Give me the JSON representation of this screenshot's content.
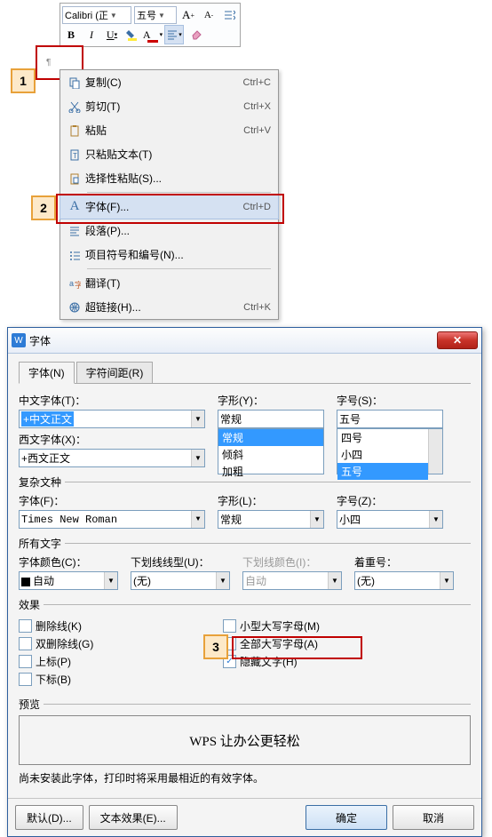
{
  "toolbar": {
    "font_name": "Calibri (正",
    "font_size": "五号"
  },
  "callouts": {
    "c1": "1",
    "c2": "2",
    "c3": "3"
  },
  "context_menu": {
    "copy": {
      "label": "复制(C)",
      "shortcut": "Ctrl+C"
    },
    "cut": {
      "label": "剪切(T)",
      "shortcut": "Ctrl+X"
    },
    "paste": {
      "label": "粘贴",
      "shortcut": "Ctrl+V"
    },
    "paste_text": {
      "label": "只粘贴文本(T)"
    },
    "paste_special": {
      "label": "选择性粘贴(S)..."
    },
    "font": {
      "label": "字体(F)...",
      "shortcut": "Ctrl+D"
    },
    "paragraph": {
      "label": "段落(P)..."
    },
    "bullets": {
      "label": "项目符号和编号(N)..."
    },
    "translate": {
      "label": "翻译(T)"
    },
    "hyperlink": {
      "label": "超链接(H)...",
      "shortcut": "Ctrl+K"
    }
  },
  "dialog": {
    "title": "字体",
    "tabs": {
      "font": "字体(N)",
      "spacing": "字符间距(R)"
    },
    "cn_font_label": "中文字体(T)：",
    "cn_font_value": "+中文正文",
    "style_label": "字形(Y)：",
    "style_value": "常规",
    "style_options": [
      "常规",
      "倾斜",
      "加粗"
    ],
    "size_label": "字号(S)：",
    "size_value": "五号",
    "size_options": [
      "四号",
      "小四",
      "五号"
    ],
    "en_font_label": "西文字体(X)：",
    "en_font_value": "+西文正文",
    "complex_heading": "复杂文种",
    "complex_font_label": "字体(F)：",
    "complex_font_value": "Times New Roman",
    "complex_style_label": "字形(L)：",
    "complex_style_value": "常规",
    "complex_size_label": "字号(Z)：",
    "complex_size_value": "小四",
    "all_text_heading": "所有文字",
    "font_color_label": "字体颜色(C)：",
    "font_color_value": "自动",
    "underline_label": "下划线线型(U)：",
    "underline_value": "(无)",
    "underline_color_label": "下划线颜色(I)：",
    "underline_color_value": "自动",
    "emphasis_label": "着重号：",
    "emphasis_value": "(无)",
    "effects_heading": "效果",
    "effects": {
      "strike": "删除线(K)",
      "dstrike": "双删除线(G)",
      "superscript": "上标(P)",
      "subscript": "下标(B)",
      "smallcaps": "小型大写字母(M)",
      "allcaps": "全部大写字母(A)",
      "hidden": "隐藏文字(H)"
    },
    "preview_heading": "预览",
    "preview_text": "WPS 让办公更轻松",
    "note_text": "尚未安装此字体，打印时将采用最相近的有效字体。",
    "buttons": {
      "default": "默认(D)...",
      "text_effect": "文本效果(E)...",
      "ok": "确定",
      "cancel": "取消"
    }
  }
}
